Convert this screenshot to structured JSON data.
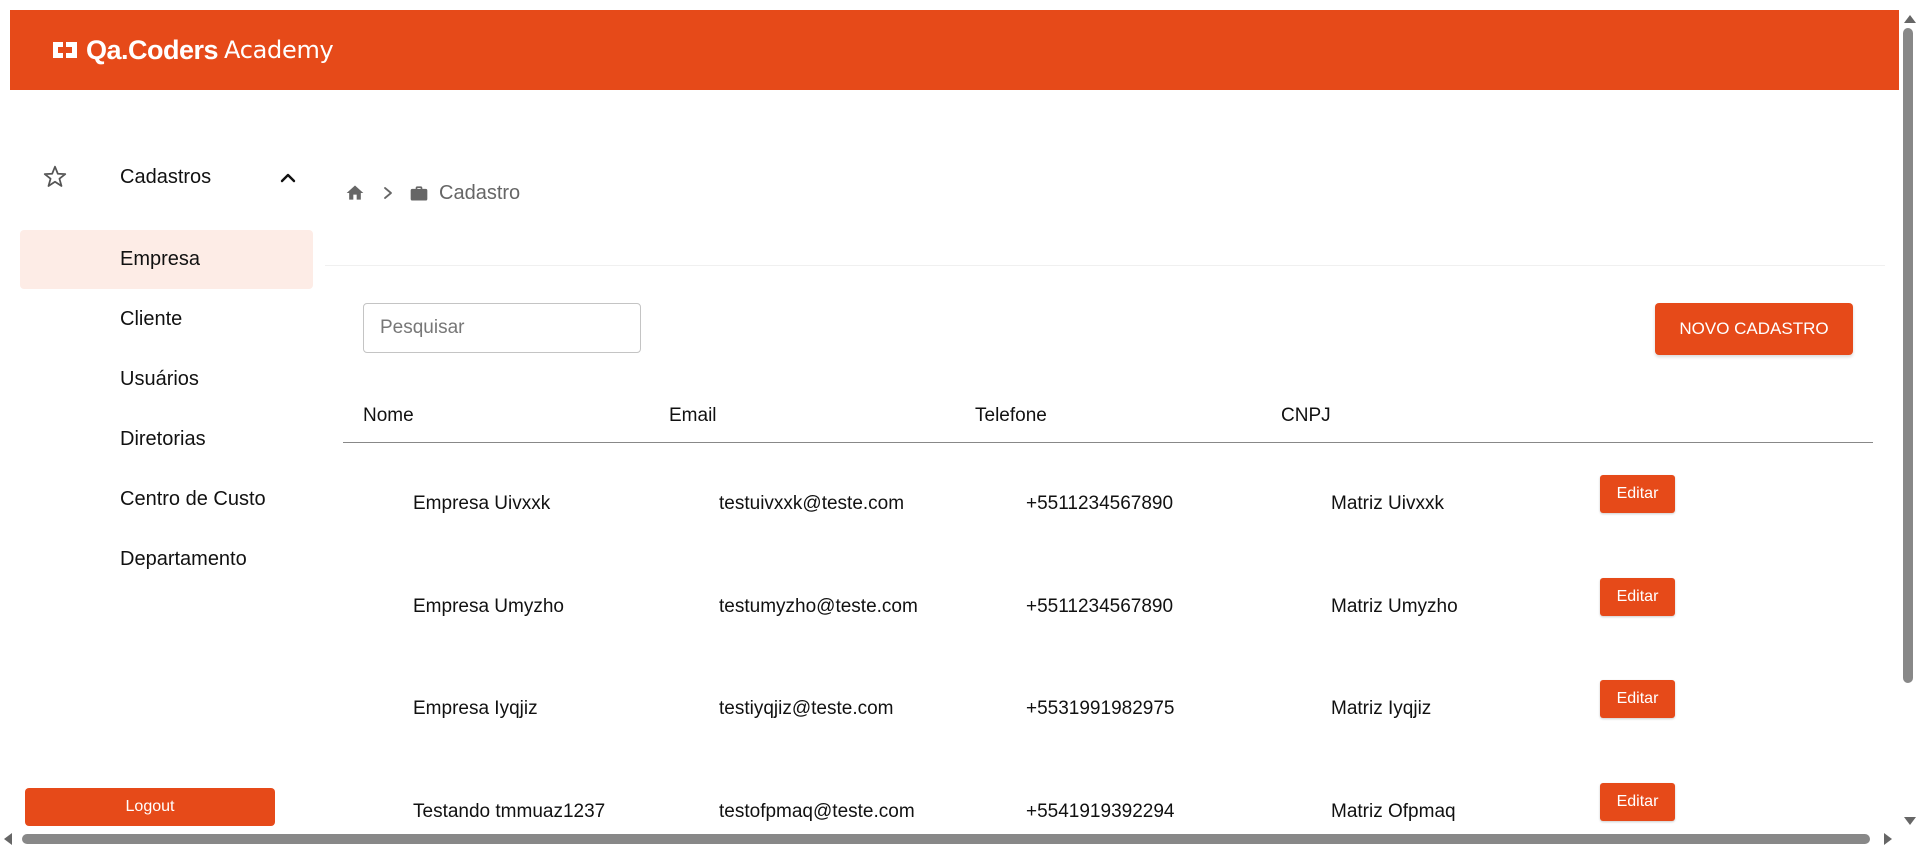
{
  "colors": {
    "brand": "#e64a19",
    "active_bg": "#fdece6"
  },
  "header": {
    "logo_bold": "Qa.Coders",
    "logo_light": "Academy"
  },
  "sidebar": {
    "group": {
      "label": "Cadastros",
      "icon": "star-icon",
      "toggle_icon": "chevron-up-icon"
    },
    "items": [
      {
        "label": "Empresa",
        "active": true
      },
      {
        "label": "Cliente"
      },
      {
        "label": "Usuários"
      },
      {
        "label": "Diretorias"
      },
      {
        "label": "Centro de Custo"
      },
      {
        "label": "Departamento"
      }
    ],
    "logout_label": "Logout"
  },
  "breadcrumb": {
    "home_icon": "home-icon",
    "separator_icon": "chevron-right-icon",
    "page_icon": "briefcase-icon",
    "label": "Cadastro"
  },
  "search": {
    "placeholder": "Pesquisar"
  },
  "actions": {
    "new_label": "NOVO CADASTRO"
  },
  "table": {
    "columns": [
      "Nome",
      "Email",
      "Telefone",
      "CNPJ"
    ],
    "edit_label": "Editar",
    "rows": [
      {
        "nome": "Empresa Uivxxk",
        "email": "testuivxxk@teste.com",
        "telefone": "+5511234567890",
        "cnpj": "Matriz Uivxxk"
      },
      {
        "nome": "Empresa Umyzho",
        "email": "testumyzho@teste.com",
        "telefone": "+5511234567890",
        "cnpj": "Matriz Umyzho"
      },
      {
        "nome": "Empresa Iyqjiz",
        "email": "testiyqjiz@teste.com",
        "telefone": "+5531991982975",
        "cnpj": "Matriz Iyqjiz"
      },
      {
        "nome": "Testando tmmuaz1237",
        "email": "testofpmaq@teste.com",
        "telefone": "+5541919392294",
        "cnpj": "Matriz Ofpmaq"
      }
    ]
  }
}
